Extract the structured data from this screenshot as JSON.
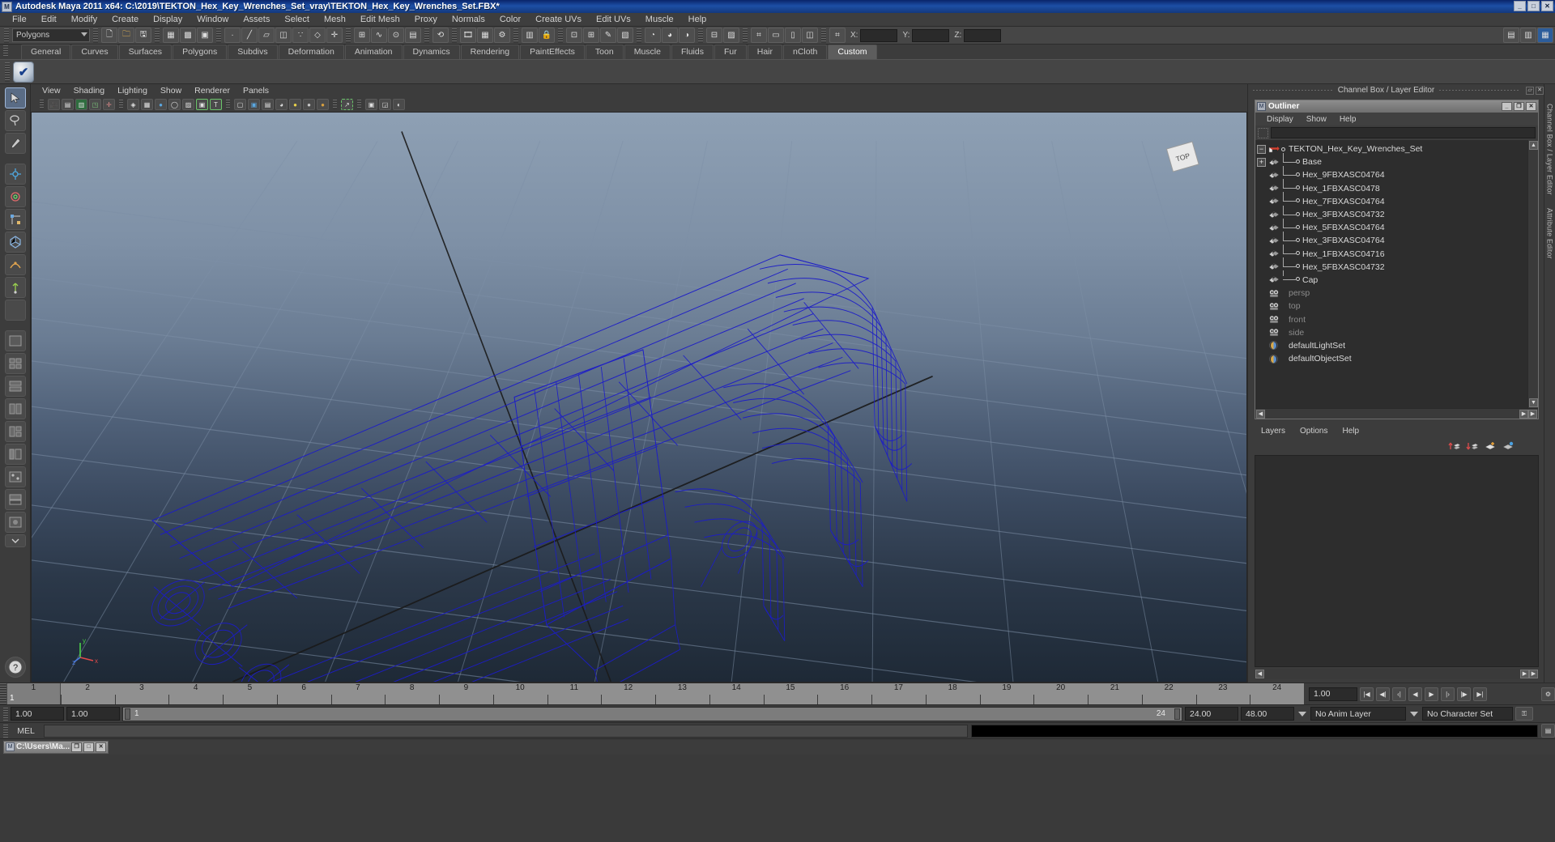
{
  "window": {
    "title": "Autodesk Maya 2011 x64: C:\\2019\\TEKTON_Hex_Key_Wrenches_Set_vray\\TEKTON_Hex_Key_Wrenches_Set.FBX*",
    "minimize": "_",
    "maximize": "□",
    "close": "✕",
    "app_icon": "maya-icon"
  },
  "menubar": {
    "items": [
      "File",
      "Edit",
      "Modify",
      "Create",
      "Display",
      "Window",
      "Assets",
      "Select",
      "Mesh",
      "Edit Mesh",
      "Proxy",
      "Normals",
      "Color",
      "Create UVs",
      "Edit UVs",
      "Muscle",
      "Help"
    ]
  },
  "toolbar": {
    "selection_mode": "Polygons",
    "coord_labels": [
      "X:",
      "Y:",
      "Z:"
    ],
    "coord_values": [
      "",
      "",
      ""
    ]
  },
  "shelf": {
    "tabs": [
      "General",
      "Curves",
      "Surfaces",
      "Polygons",
      "Subdivs",
      "Deformation",
      "Animation",
      "Dynamics",
      "Rendering",
      "PaintEffects",
      "Toon",
      "Muscle",
      "Fluids",
      "Fur",
      "Hair",
      "nCloth",
      "Custom"
    ],
    "active_tab": "Custom",
    "button_icon": "checkmark-sphere-icon"
  },
  "viewport": {
    "menus": [
      "View",
      "Shading",
      "Lighting",
      "Show",
      "Renderer",
      "Panels"
    ],
    "viewcube_label": "TOP",
    "axis_labels": {
      "x": "x",
      "y": "y",
      "z": "z"
    },
    "background_top_color": "#8ea0b4",
    "background_bottom_color": "#1e2936",
    "wireframe_color": "#1616c8",
    "grid_color": "#5a6b80"
  },
  "channelbox": {
    "header": "Channel Box / Layer Editor",
    "vertical_tabs": [
      "Channel Box / Layer Editor",
      "Attribute Editor"
    ]
  },
  "outliner": {
    "title": "Outliner",
    "window_buttons": [
      "_",
      "❐",
      "✕"
    ],
    "menus": [
      "Display",
      "Show",
      "Help"
    ],
    "search_value": "",
    "search_placeholder": "",
    "items": [
      {
        "label": "TEKTON_Hex_Key_Wrenches_Set",
        "indent": 0,
        "icon": "transform-arrow-icon",
        "expander": "minus",
        "dim": false
      },
      {
        "label": "Base",
        "indent": 1,
        "icon": "mesh-icon",
        "expander": "plus",
        "dim": false
      },
      {
        "label": "Hex_9FBXASC04764",
        "indent": 1,
        "icon": "mesh-icon",
        "expander": "none",
        "dim": false
      },
      {
        "label": "Hex_1FBXASC0478",
        "indent": 1,
        "icon": "mesh-icon",
        "expander": "none",
        "dim": false
      },
      {
        "label": "Hex_7FBXASC04764",
        "indent": 1,
        "icon": "mesh-icon",
        "expander": "none",
        "dim": false
      },
      {
        "label": "Hex_3FBXASC04732",
        "indent": 1,
        "icon": "mesh-icon",
        "expander": "none",
        "dim": false
      },
      {
        "label": "Hex_5FBXASC04764",
        "indent": 1,
        "icon": "mesh-icon",
        "expander": "none",
        "dim": false
      },
      {
        "label": "Hex_3FBXASC04764",
        "indent": 1,
        "icon": "mesh-icon",
        "expander": "none",
        "dim": false
      },
      {
        "label": "Hex_1FBXASC04716",
        "indent": 1,
        "icon": "mesh-icon",
        "expander": "none",
        "dim": false
      },
      {
        "label": "Hex_5FBXASC04732",
        "indent": 1,
        "icon": "mesh-icon",
        "expander": "none",
        "dim": false
      },
      {
        "label": "Cap",
        "indent": 1,
        "icon": "mesh-icon",
        "expander": "none",
        "dim": false
      },
      {
        "label": "persp",
        "indent": 0,
        "icon": "camera-icon",
        "expander": "none",
        "dim": true
      },
      {
        "label": "top",
        "indent": 0,
        "icon": "camera-icon",
        "expander": "none",
        "dim": true
      },
      {
        "label": "front",
        "indent": 0,
        "icon": "camera-icon",
        "expander": "none",
        "dim": true
      },
      {
        "label": "side",
        "indent": 0,
        "icon": "camera-icon",
        "expander": "none",
        "dim": true
      },
      {
        "label": "defaultLightSet",
        "indent": 0,
        "icon": "set-sphere-icon",
        "expander": "none",
        "dim": false
      },
      {
        "label": "defaultObjectSet",
        "indent": 0,
        "icon": "set-sphere-icon",
        "expander": "none",
        "dim": false
      }
    ]
  },
  "layereditor": {
    "menus": [
      "Layers",
      "Options",
      "Help"
    ],
    "tool_icons": [
      "layer-up-icon",
      "layer-down-icon",
      "new-layer-icon",
      "new-layer-selected-icon"
    ],
    "layers": []
  },
  "timeline": {
    "frames": [
      "1",
      "2",
      "3",
      "4",
      "5",
      "6",
      "7",
      "8",
      "9",
      "10",
      "11",
      "12",
      "13",
      "14",
      "15",
      "16",
      "17",
      "18",
      "19",
      "20",
      "21",
      "22",
      "23",
      "24"
    ],
    "current_frame": "1",
    "current_frame_field": "1.00",
    "transport_icons": [
      "go-to-start-icon",
      "step-back-key-icon",
      "step-back-frame-icon",
      "play-backwards-icon",
      "play-forwards-icon",
      "step-forward-frame-icon",
      "step-forward-key-icon",
      "go-to-end-icon"
    ]
  },
  "rangebar": {
    "start_field": "1.00",
    "end_field": "1.00",
    "range_start_label": "1",
    "range_end_label": "24",
    "playback_start": "24.00",
    "playback_end": "48.00",
    "anim_layer": "No Anim Layer",
    "character_set": "No Character Set",
    "key_icon": "key-icon"
  },
  "mel": {
    "label": "MEL",
    "command_value": ""
  },
  "taskbar": {
    "button_label": "C:\\Users\\Ma...",
    "button_icon": "maya-icon",
    "window_buttons": [
      "❐",
      "□",
      "✕"
    ]
  },
  "toolbox": {
    "tools": [
      "select-tool",
      "lasso-select-tool",
      "paint-select-tool",
      "move-tool",
      "rotate-tool",
      "scale-tool",
      "universal-manipulator-tool",
      "soft-modification-tool",
      "show-manipulator-tool",
      "last-tool-used",
      "layout-single-icon",
      "layout-four-icon",
      "layout-two-stacked-icon",
      "layout-two-side-icon",
      "layout-three-icon",
      "layout-outliner-persp-icon",
      "layout-hypergraph-icon",
      "layout-persp-graph-icon",
      "layout-hypershade-icon",
      "more-layouts-icon",
      "help-icon"
    ]
  },
  "chart_data": null
}
